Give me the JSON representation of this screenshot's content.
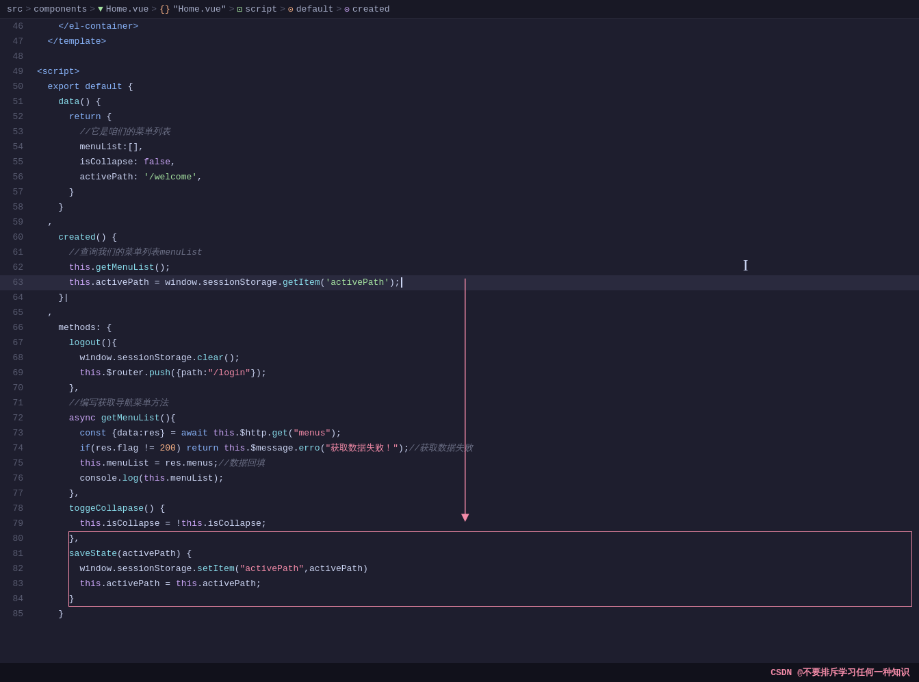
{
  "breadcrumb": {
    "items": [
      {
        "label": "src",
        "type": "text"
      },
      {
        "label": ">",
        "type": "sep"
      },
      {
        "label": "components",
        "type": "text"
      },
      {
        "label": ">",
        "type": "sep"
      },
      {
        "label": "▼",
        "type": "icon"
      },
      {
        "label": "Home.vue",
        "type": "highlight"
      },
      {
        "label": ">",
        "type": "sep"
      },
      {
        "label": "{}",
        "type": "icon-code"
      },
      {
        "label": "\"Home.vue\"",
        "type": "highlight"
      },
      {
        "label": ">",
        "type": "sep"
      },
      {
        "label": "script",
        "type": "highlight"
      },
      {
        "label": ">",
        "type": "sep"
      },
      {
        "label": "⊙",
        "type": "icon-circle"
      },
      {
        "label": "default",
        "type": "highlight"
      },
      {
        "label": ">",
        "type": "sep"
      },
      {
        "label": "⊙",
        "type": "icon-circle2"
      },
      {
        "label": "created",
        "type": "highlight"
      }
    ]
  },
  "lines": [
    {
      "num": 46,
      "content": "    </el-container>"
    },
    {
      "num": 47,
      "content": "  </template>"
    },
    {
      "num": 48,
      "content": ""
    },
    {
      "num": 49,
      "content": "<script>"
    },
    {
      "num": 50,
      "content": "  export default {"
    },
    {
      "num": 51,
      "content": "    data() {"
    },
    {
      "num": 52,
      "content": "      return {"
    },
    {
      "num": 53,
      "content": "        //它是咱们的菜单列表"
    },
    {
      "num": 54,
      "content": "        menuList:[],"
    },
    {
      "num": 55,
      "content": "        isCollapse: false,"
    },
    {
      "num": 56,
      "content": "        activePath: '/welcome',"
    },
    {
      "num": 57,
      "content": "      }"
    },
    {
      "num": 58,
      "content": "    }"
    },
    {
      "num": 59,
      "content": "  ,"
    },
    {
      "num": 60,
      "content": "    created() {"
    },
    {
      "num": 61,
      "content": "      //查询我们的菜单列表menuList"
    },
    {
      "num": 62,
      "content": "      this.getMenuList();"
    },
    {
      "num": 63,
      "content": "      this.activePath = window.sessionStorage.getItem('activePath');",
      "active": true
    },
    {
      "num": 64,
      "content": "    }|"
    },
    {
      "num": 65,
      "content": "  ,"
    },
    {
      "num": 66,
      "content": "    methods: {"
    },
    {
      "num": 67,
      "content": "      logout(){"
    },
    {
      "num": 68,
      "content": "        window.sessionStorage.clear();"
    },
    {
      "num": 69,
      "content": "        this.$router.push({path:\"/login\"});"
    },
    {
      "num": 70,
      "content": "      },"
    },
    {
      "num": 71,
      "content": "      //编写获取导航菜单方法"
    },
    {
      "num": 72,
      "content": "      async getMenuList(){"
    },
    {
      "num": 73,
      "content": "        const {data:res} = await this.$http.get(\"menus\");"
    },
    {
      "num": 74,
      "content": "        if(res.flag != 200) return this.$message.erro(\"获取数据失败！\");//获取数据失败"
    },
    {
      "num": 75,
      "content": "        this.menuList = res.menus;//数据回填"
    },
    {
      "num": 76,
      "content": "        console.log(this.menuList);"
    },
    {
      "num": 77,
      "content": "      },"
    },
    {
      "num": 78,
      "content": "      toggeCollapase() {"
    },
    {
      "num": 79,
      "content": "        this.isCollapse = !this.isCollapse;"
    },
    {
      "num": 80,
      "content": "      },"
    },
    {
      "num": 81,
      "content": "      saveState(activePath) {",
      "boxed": true
    },
    {
      "num": 82,
      "content": "        window.sessionStorage.setItem(\"activePath\",activePath)",
      "boxed": true
    },
    {
      "num": 83,
      "content": "        this.activePath = this.activePath;",
      "boxed": true
    },
    {
      "num": 84,
      "content": "      }",
      "boxed": true
    },
    {
      "num": 85,
      "content": "    }",
      "boxed": true
    }
  ],
  "watermark": "CSDN @不要排斥学习任何一种知识"
}
